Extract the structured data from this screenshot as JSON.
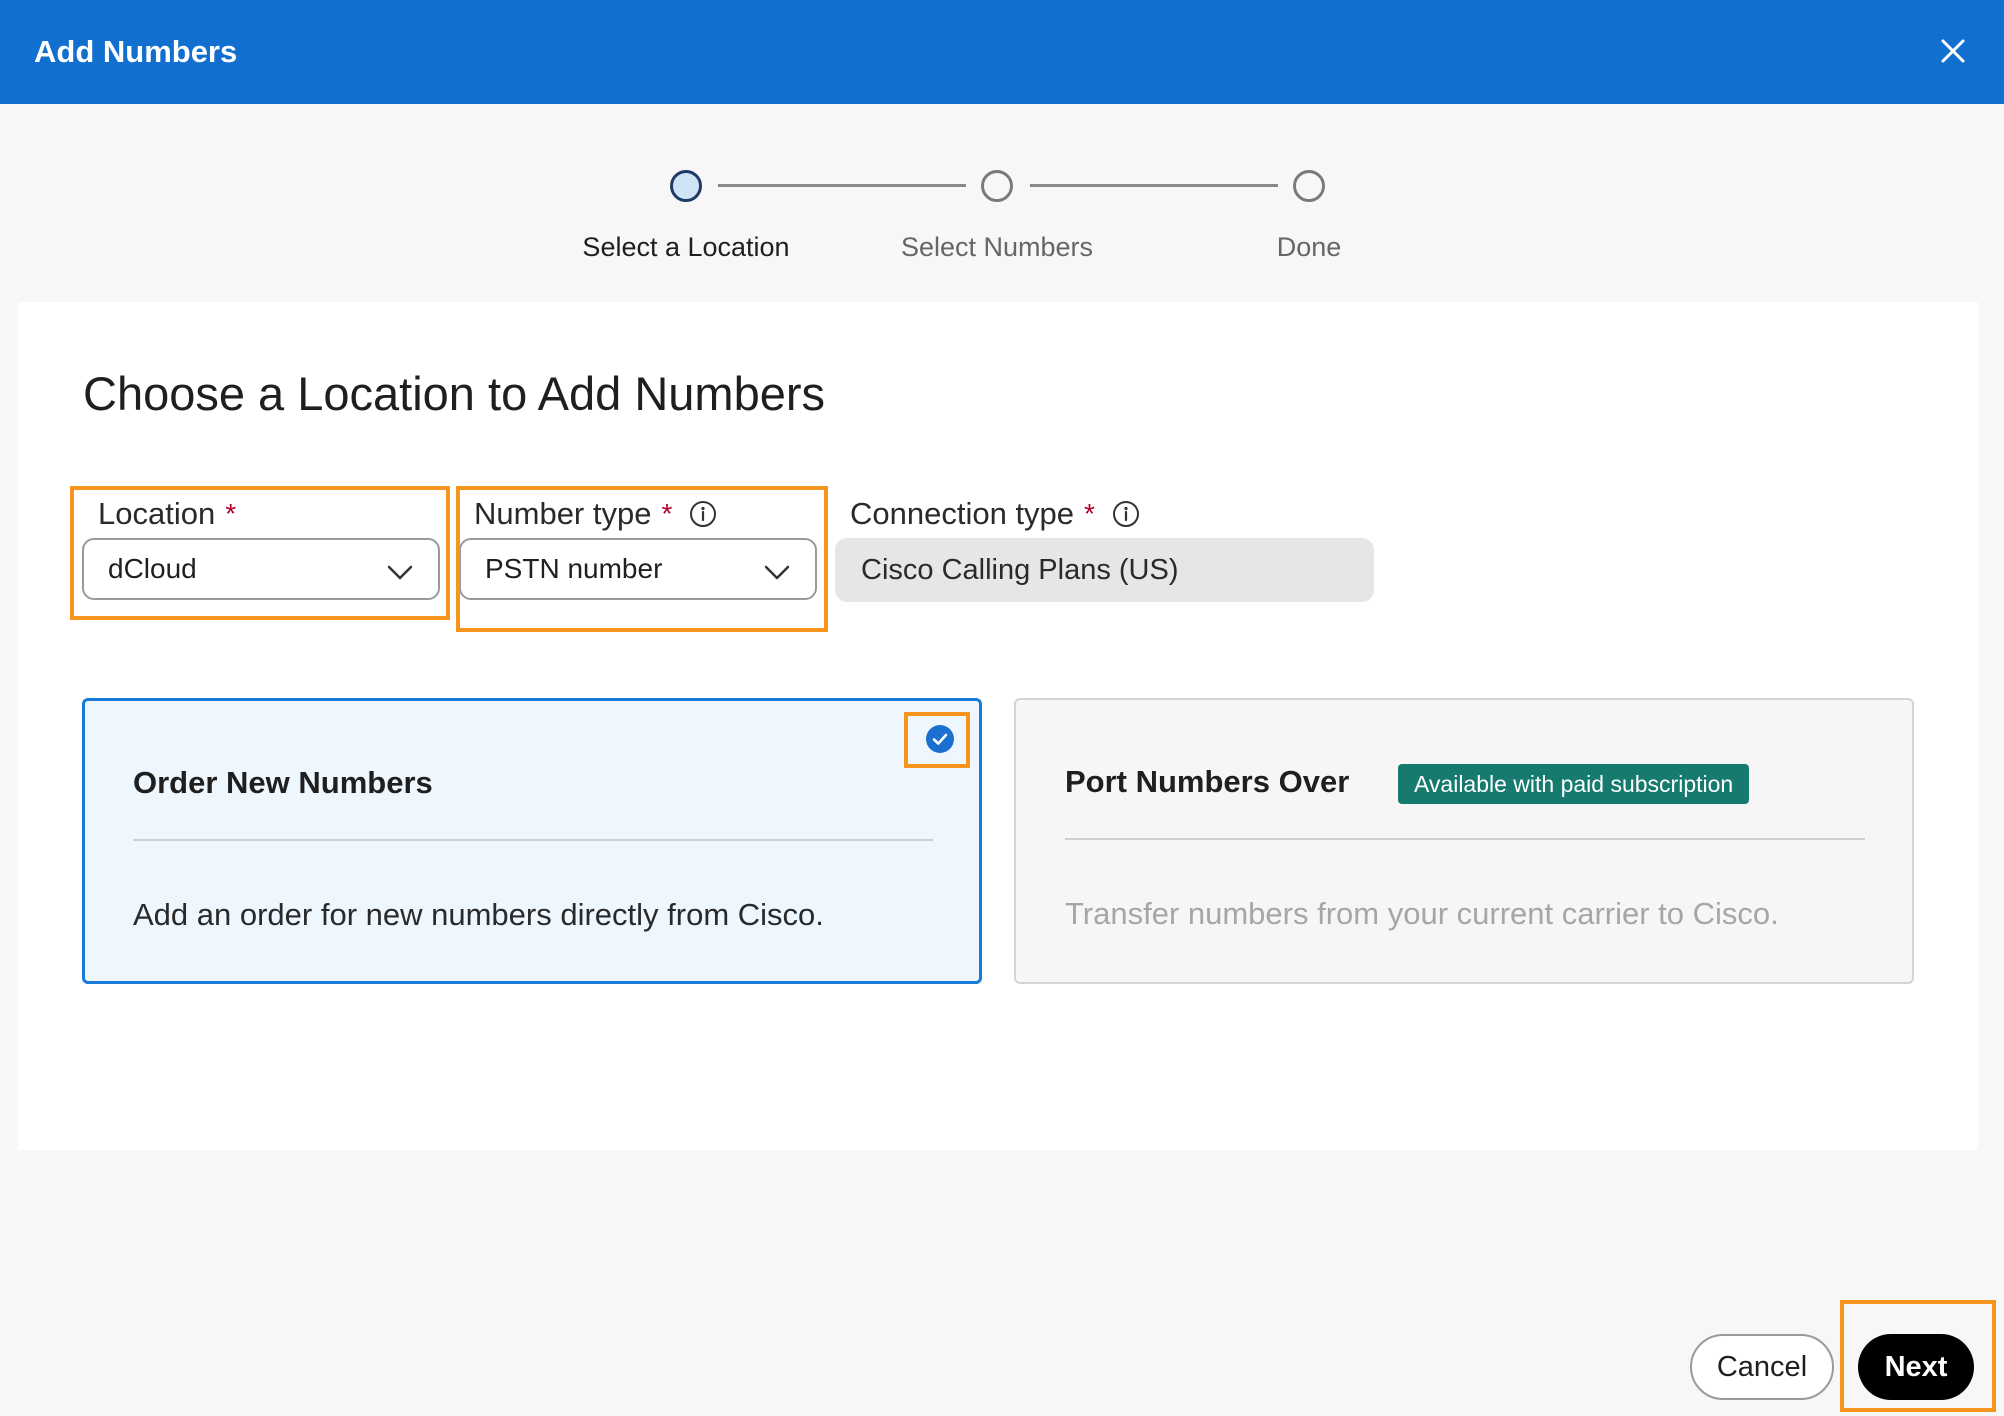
{
  "dialog": {
    "title": "Add Numbers"
  },
  "stepper": {
    "steps": [
      {
        "label": "Select a Location",
        "state": "active"
      },
      {
        "label": "Select Numbers",
        "state": "pending"
      },
      {
        "label": "Done",
        "state": "pending"
      }
    ]
  },
  "main": {
    "title": "Choose a Location to Add Numbers"
  },
  "form": {
    "location": {
      "label": "Location",
      "required_mark": "*",
      "value": "dCloud"
    },
    "number_type": {
      "label": "Number type",
      "required_mark": "*",
      "value": "PSTN number"
    },
    "connection_type": {
      "label": "Connection type",
      "required_mark": "*",
      "value": "Cisco Calling Plans (US)"
    }
  },
  "options": {
    "order_new": {
      "title": "Order New Numbers",
      "description": "Add an order for new numbers directly from Cisco.",
      "selected": true
    },
    "port_over": {
      "title": "Port Numbers Over",
      "badge": "Available with paid subscription",
      "description": "Transfer numbers from your current carrier to Cisco.",
      "disabled": true
    }
  },
  "footer": {
    "cancel_label": "Cancel",
    "next_label": "Next"
  },
  "colors": {
    "header_bg": "#1170cf",
    "selected_card_border": "#1a7ad9",
    "badge_bg": "#167a6e",
    "highlight": "#f7941d",
    "next_button_bg": "#000000"
  },
  "icons": [
    "close-icon",
    "info-icon",
    "chevron-down-icon",
    "check-circle-icon"
  ]
}
